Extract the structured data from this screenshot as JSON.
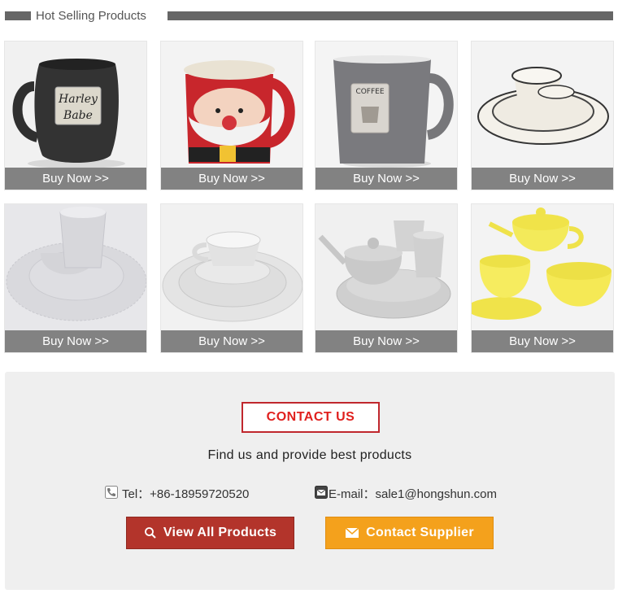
{
  "section": {
    "title": "Hot Selling Products"
  },
  "products": [
    {
      "name": "harley-babe-mug",
      "buy_label": "Buy Now >>",
      "mug_text_1": "Harley",
      "mug_text_2": "Babe"
    },
    {
      "name": "santa-mug",
      "buy_label": "Buy Now >>"
    },
    {
      "name": "coffee-mug",
      "buy_label": "Buy Now >>",
      "mug_text_1": "COFFEE"
    },
    {
      "name": "dinnerware-set-rim",
      "buy_label": "Buy Now >>"
    },
    {
      "name": "lace-dinner-set",
      "buy_label": "Buy Now >>"
    },
    {
      "name": "woven-texture-plates",
      "buy_label": "Buy Now >>"
    },
    {
      "name": "teapot-set",
      "buy_label": "Buy Now >>"
    },
    {
      "name": "yellow-tea-set",
      "buy_label": "Buy Now >>"
    }
  ],
  "contact": {
    "title": "CONTACT US",
    "subtitle": "Find us and provide best products",
    "phone": "Tel：+86-18959720520",
    "email": "E-mail：sale1@hongshun.com",
    "view_button": "View All Products",
    "supplier_button": "Contact Supplier"
  },
  "colors": {
    "header_bar": "#666666",
    "buy_bar": "#828282",
    "contact_red": "#e0201e",
    "view_button": "#b3342b",
    "supplier_button": "#f4a11c"
  }
}
